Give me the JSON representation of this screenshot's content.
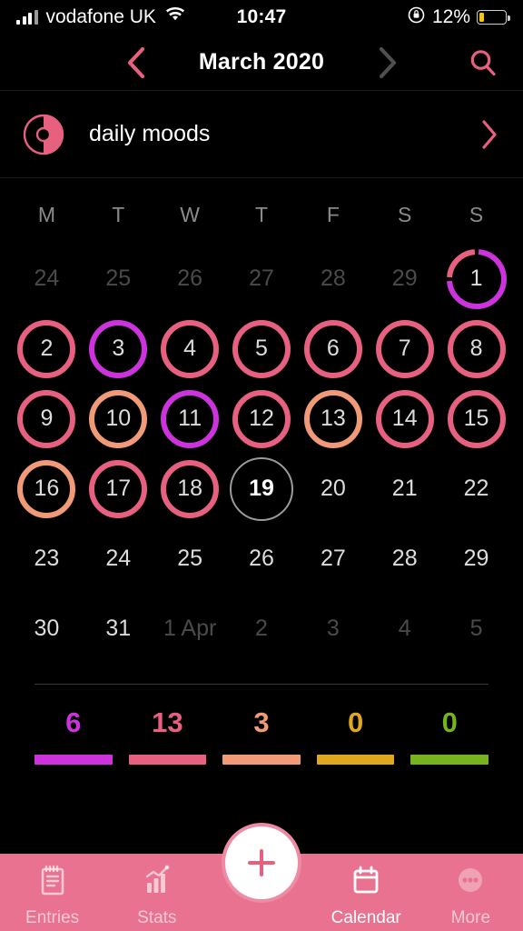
{
  "status_bar": {
    "carrier": "vodafone UK",
    "time": "10:47",
    "battery_percent": "12%",
    "signal_icon": "signal-bars-icon",
    "wifi_icon": "wifi-icon",
    "rotation_lock_icon": "rotation-lock-icon",
    "battery_icon": "battery-low-icon"
  },
  "header": {
    "title": "March 2020",
    "prev_icon": "chevron-left-icon",
    "next_icon": "chevron-right-icon",
    "search_icon": "search-icon",
    "prev_color": "#e8607f",
    "next_color": "#4f4f4f",
    "search_color": "#e8607f"
  },
  "moods_row": {
    "label": "daily moods",
    "icon": "pie-chart-icon",
    "chevron_icon": "chevron-right-icon",
    "accent": "#e8607f"
  },
  "calendar": {
    "weekdays": [
      "M",
      "T",
      "W",
      "T",
      "F",
      "S",
      "S"
    ],
    "weeks": [
      [
        {
          "label": "24",
          "month": "prev",
          "mood": null
        },
        {
          "label": "25",
          "month": "prev",
          "mood": null
        },
        {
          "label": "26",
          "month": "prev",
          "mood": null
        },
        {
          "label": "27",
          "month": "prev",
          "mood": null
        },
        {
          "label": "28",
          "month": "prev",
          "mood": null
        },
        {
          "label": "29",
          "month": "prev",
          "mood": null
        },
        {
          "label": "1",
          "month": "current",
          "mood": "split",
          "split": [
            "pink",
            "magenta"
          ]
        }
      ],
      [
        {
          "label": "2",
          "month": "current",
          "mood": "pink"
        },
        {
          "label": "3",
          "month": "current",
          "mood": "magenta"
        },
        {
          "label": "4",
          "month": "current",
          "mood": "pink"
        },
        {
          "label": "5",
          "month": "current",
          "mood": "pink"
        },
        {
          "label": "6",
          "month": "current",
          "mood": "pink"
        },
        {
          "label": "7",
          "month": "current",
          "mood": "pink"
        },
        {
          "label": "8",
          "month": "current",
          "mood": "pink"
        }
      ],
      [
        {
          "label": "9",
          "month": "current",
          "mood": "pink"
        },
        {
          "label": "10",
          "month": "current",
          "mood": "orange"
        },
        {
          "label": "11",
          "month": "current",
          "mood": "magenta"
        },
        {
          "label": "12",
          "month": "current",
          "mood": "pink"
        },
        {
          "label": "13",
          "month": "current",
          "mood": "orange"
        },
        {
          "label": "14",
          "month": "current",
          "mood": "pink"
        },
        {
          "label": "15",
          "month": "current",
          "mood": "pink"
        }
      ],
      [
        {
          "label": "16",
          "month": "current",
          "mood": "orange"
        },
        {
          "label": "17",
          "month": "current",
          "mood": "pink"
        },
        {
          "label": "18",
          "month": "current",
          "mood": "pink"
        },
        {
          "label": "19",
          "month": "current",
          "mood": null,
          "today": true
        },
        {
          "label": "20",
          "month": "current",
          "mood": null
        },
        {
          "label": "21",
          "month": "current",
          "mood": null
        },
        {
          "label": "22",
          "month": "current",
          "mood": null
        }
      ],
      [
        {
          "label": "23",
          "month": "current",
          "mood": null
        },
        {
          "label": "24",
          "month": "current",
          "mood": null
        },
        {
          "label": "25",
          "month": "current",
          "mood": null
        },
        {
          "label": "26",
          "month": "current",
          "mood": null
        },
        {
          "label": "27",
          "month": "current",
          "mood": null
        },
        {
          "label": "28",
          "month": "current",
          "mood": null
        },
        {
          "label": "29",
          "month": "current",
          "mood": null
        }
      ],
      [
        {
          "label": "30",
          "month": "current",
          "mood": null
        },
        {
          "label": "31",
          "month": "current",
          "mood": null
        },
        {
          "label": "1 Apr",
          "month": "next",
          "mood": null
        },
        {
          "label": "2",
          "month": "next",
          "mood": null
        },
        {
          "label": "3",
          "month": "next",
          "mood": null
        },
        {
          "label": "4",
          "month": "next",
          "mood": null
        },
        {
          "label": "5",
          "month": "next",
          "mood": null
        }
      ]
    ]
  },
  "summary": [
    {
      "count": "6",
      "color": "#cc33dd"
    },
    {
      "count": "13",
      "color": "#e8607f"
    },
    {
      "count": "3",
      "color": "#f09a77"
    },
    {
      "count": "0",
      "color": "#e0a81e"
    },
    {
      "count": "0",
      "color": "#76b31e"
    }
  ],
  "tabbar": {
    "background": "#e8728f",
    "items": [
      {
        "label": "Entries",
        "icon": "notebook-icon",
        "active": false
      },
      {
        "label": "Stats",
        "icon": "bar-chart-icon",
        "active": false
      },
      {
        "label": "Calendar",
        "icon": "calendar-icon",
        "active": true
      },
      {
        "label": "More",
        "icon": "ellipsis-icon",
        "active": false
      }
    ],
    "add_button_icon": "plus-icon"
  },
  "mood_colors": {
    "magenta": "#cc33dd",
    "pink": "#e8607f",
    "orange": "#f09a77",
    "gold": "#e0a81e",
    "green": "#76b31e"
  }
}
